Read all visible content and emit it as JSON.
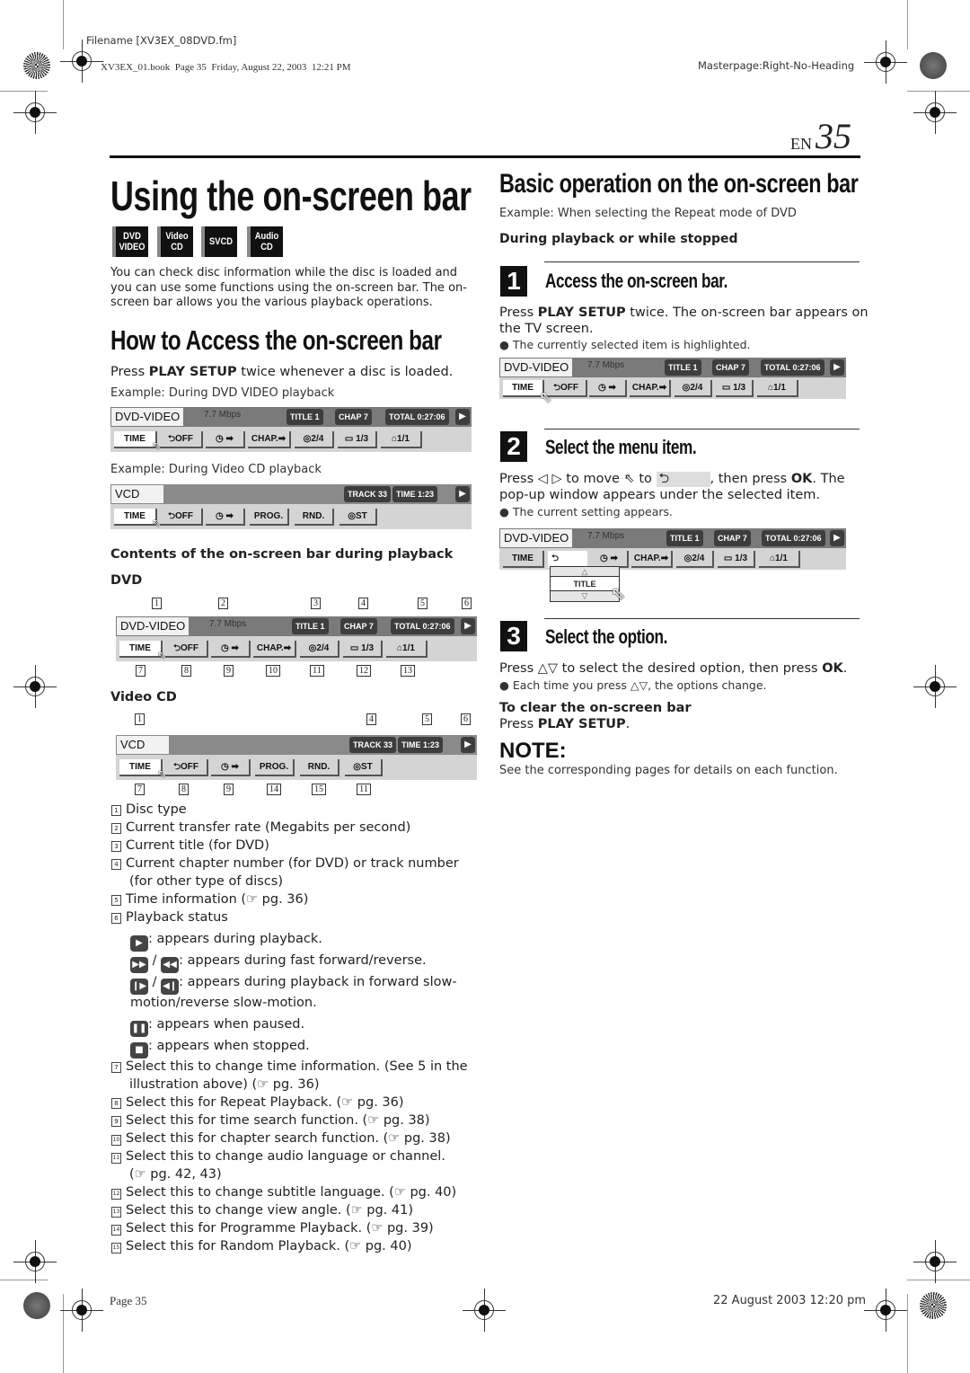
{
  "header": {
    "filename": "Filename [XV3EX_08DVD.fm]",
    "book_info": "XV3EX_01.book  Page 35  Friday, August 22, 2003  12:21 PM",
    "masterpage": "Masterpage:Right-No-Heading",
    "lang": "EN",
    "page_number": "35"
  },
  "left": {
    "title": "Using the on-screen bar",
    "disc_badges": [
      {
        "line1": "DVD",
        "line2": "VIDEO"
      },
      {
        "line1": "Video",
        "line2": "CD"
      },
      {
        "line1": "SVCD",
        "line2": ""
      },
      {
        "line1": "Audio",
        "line2": "CD"
      }
    ],
    "intro": "You can check disc information while the disc is loaded and you can use some functions using the on-screen bar. The on-screen bar allows you the various playback operations.",
    "section_title": "How to Access the on-screen bar",
    "press_prefix": "Press ",
    "press_key": "PLAY SETUP",
    "press_suffix": " twice whenever a disc is loaded.",
    "example_dvd": "Example: During DVD VIDEO playback",
    "example_vcd": "Example: During Video CD playback",
    "contents_title": "Contents of the on-screen bar during playback",
    "dvd_label": "DVD",
    "vcd_label": "Video CD",
    "dvd_callouts_top": [
      "1",
      "2",
      "3",
      "4",
      "5",
      "6"
    ],
    "dvd_callouts_bottom": [
      "7",
      "8",
      "9",
      "10",
      "11",
      "12",
      "13"
    ],
    "vcd_callouts_top": [
      "1",
      "4",
      "5",
      "6"
    ],
    "vcd_callouts_bottom": [
      "7",
      "8",
      "9",
      "14",
      "15",
      "11"
    ],
    "legend": [
      {
        "n": "1",
        "text": "Disc type"
      },
      {
        "n": "2",
        "text": "Current transfer rate (Megabits per second)"
      },
      {
        "n": "3",
        "text": "Current title (for DVD)"
      },
      {
        "n": "4",
        "text": "Current chapter number (for DVD) or track number"
      },
      {
        "n": "",
        "text": "(for other type of discs)"
      },
      {
        "n": "5",
        "text": "Time information (☞ pg. 36)"
      },
      {
        "n": "6",
        "text": "Playback status"
      }
    ],
    "status_lines": [
      {
        "icons": [
          "play-icon"
        ],
        "text": ": appears during playback."
      },
      {
        "icons": [
          "fast-forward-icon",
          "fast-reverse-icon"
        ],
        "text": ": appears during fast forward/reverse."
      },
      {
        "icons": [
          "slow-forward-icon",
          "slow-reverse-icon"
        ],
        "text": ": appears during playback in forward slow-"
      },
      {
        "icons": [],
        "text": "motion/reverse slow-motion."
      },
      {
        "icons": [
          "pause-icon"
        ],
        "text": ": appears when paused."
      },
      {
        "icons": [
          "stop-icon"
        ],
        "text": ": appears when stopped."
      }
    ],
    "legend2": [
      {
        "n": "7",
        "text": "Select this to change time information. (See 5 in the"
      },
      {
        "n": "",
        "text": "illustration above) (☞ pg. 36)"
      },
      {
        "n": "8",
        "text": "Select this for Repeat Playback. (☞ pg. 36)"
      },
      {
        "n": "9",
        "text": "Select this for time search function. (☞ pg. 38)"
      },
      {
        "n": "10",
        "text": "Select this for chapter search function. (☞ pg. 38)"
      },
      {
        "n": "11",
        "text": "Select this to change audio language or channel."
      },
      {
        "n": "",
        "text": "(☞ pg. 42, 43)"
      },
      {
        "n": "12",
        "text": "Select this to change subtitle language. (☞ pg. 40)"
      },
      {
        "n": "13",
        "text": "Select this to change view angle. (☞ pg. 41)"
      },
      {
        "n": "14",
        "text": "Select this for Programme Playback. (☞ pg. 39)"
      },
      {
        "n": "15",
        "text": "Select this for Random Playback. (☞ pg. 40)"
      }
    ]
  },
  "osb_dvd": {
    "disc": "DVD-VIDEO",
    "rate": "7.7 Mbps",
    "title": "TITLE    1",
    "chap": "CHAP    7",
    "total": "TOTAL  0:27:06",
    "play": "▶",
    "buttons": [
      "TIME",
      "⮌OFF",
      "◷ ➡",
      "CHAP.➡",
      "◎2/4",
      "▭ 1/3",
      "⌂1/1"
    ]
  },
  "osb_vcd": {
    "disc": "VCD",
    "track": "TRACK 33",
    "time": "TIME     1:23",
    "play": "▶",
    "buttons": [
      "TIME",
      "⮌OFF",
      "◷ ➡",
      "PROG.",
      "RND.",
      "◎ST"
    ]
  },
  "osb_popup": {
    "buttons": [
      "TIME",
      "⮌",
      "◷ ➡",
      "CHAP.➡",
      "◎2/4",
      "▭ 1/3",
      "⌂1/1"
    ],
    "up": "△",
    "option": "TITLE",
    "down": "▽"
  },
  "right": {
    "title": "Basic operation on the on-screen bar",
    "example": "Example: When selecting the Repeat mode of DVD",
    "during": "During playback or while stopped",
    "steps": [
      {
        "num": "1",
        "title": "Access the on-screen bar."
      },
      {
        "num": "2",
        "title": "Select the menu item."
      },
      {
        "num": "3",
        "title": "Select the option."
      }
    ],
    "step1_a": "Press ",
    "step1_key": "PLAY SETUP",
    "step1_b": " twice. The on-screen bar appears on",
    "step1_c": "the TV screen.",
    "step1_bullet": "● The currently selected item is highlighted.",
    "step2_a": "Press ◁ ▷ to move ⇖ to ",
    "step2_icon": "⮌",
    "step2_b": ", then press ",
    "step2_key": "OK",
    "step2_c": ". The",
    "step2_d": "pop-up window appears under the selected item.",
    "step2_bullet": "● The current setting appears.",
    "step3_a": "Press △▽ to select the desired option, then press ",
    "step3_key": "OK",
    "step3_b": ".",
    "step3_bullet": "● Each time you press △▽, the options change.",
    "clear_title": "To clear the on-screen bar",
    "clear_a": "Press ",
    "clear_key": "PLAY SETUP",
    "clear_b": ".",
    "note_title": "NOTE:",
    "note_text": "See the corresponding pages for details on each function."
  },
  "footer": {
    "page": "Page 35",
    "date": "22 August 2003 12:20 pm"
  }
}
